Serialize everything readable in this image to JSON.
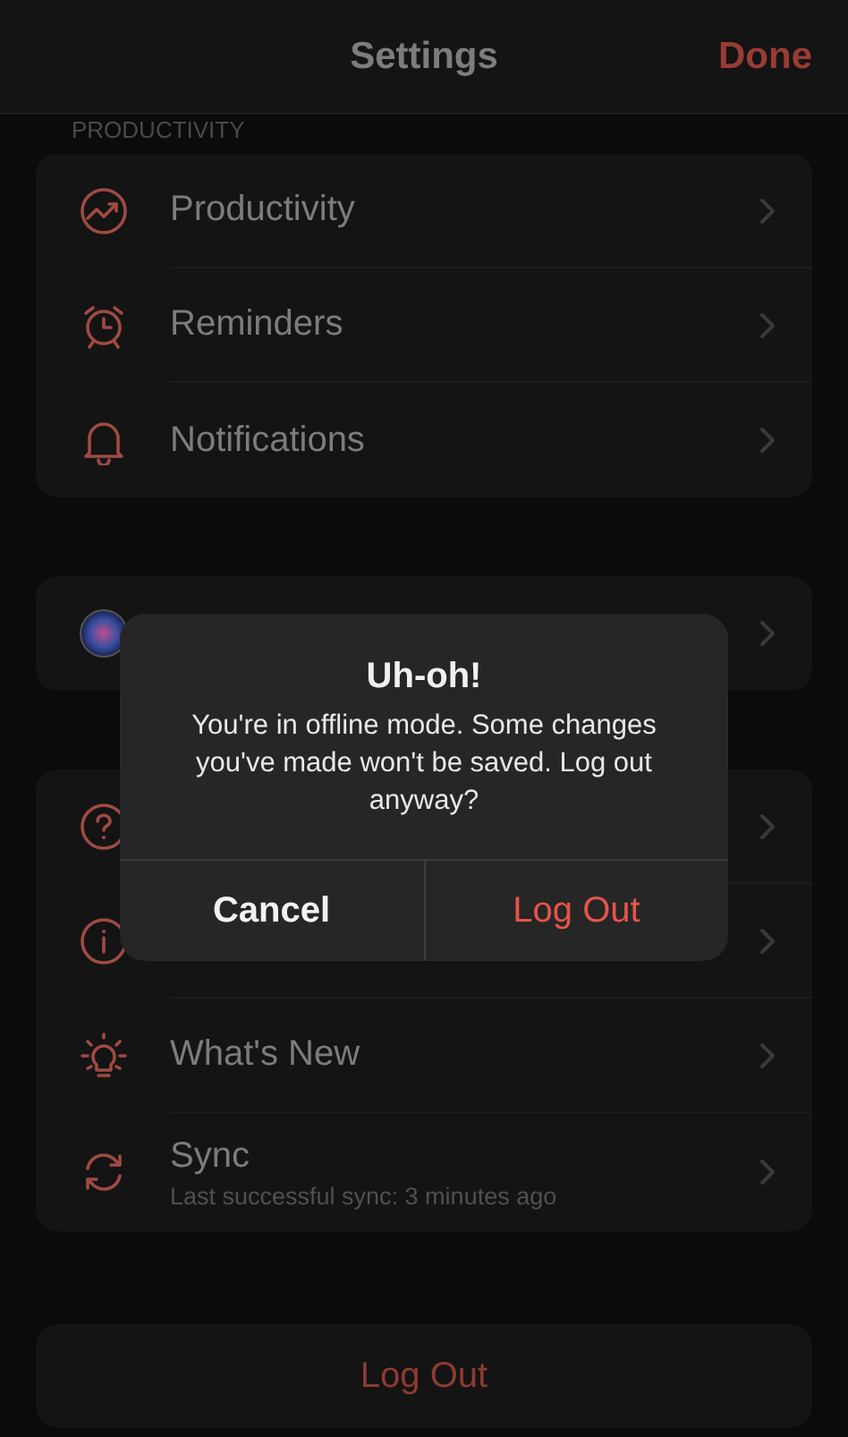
{
  "nav": {
    "title": "Settings",
    "done": "Done"
  },
  "sections": [
    {
      "header": "PRODUCTIVITY",
      "rows": [
        {
          "kind": "chart",
          "label": "Productivity"
        },
        {
          "kind": "alarm",
          "label": "Reminders"
        },
        {
          "kind": "bell",
          "label": "Notifications"
        }
      ]
    },
    {
      "rows": [
        {
          "kind": "siri"
        }
      ]
    },
    {
      "rows": [
        {
          "kind": "help"
        },
        {
          "kind": "info"
        },
        {
          "kind": "bulb",
          "label": "What's New"
        },
        {
          "kind": "sync",
          "label": "Sync",
          "subtitle": "Last successful sync: 3 minutes ago"
        }
      ]
    }
  ],
  "logout": "Log Out",
  "alert": {
    "title": "Uh-oh!",
    "message": "You're in offline mode. Some changes you've made won't be saved. Log out anyway?",
    "buttons": [
      {
        "label": "Cancel",
        "kind": "default"
      },
      {
        "label": "Log Out",
        "kind": "destructive"
      }
    ]
  }
}
